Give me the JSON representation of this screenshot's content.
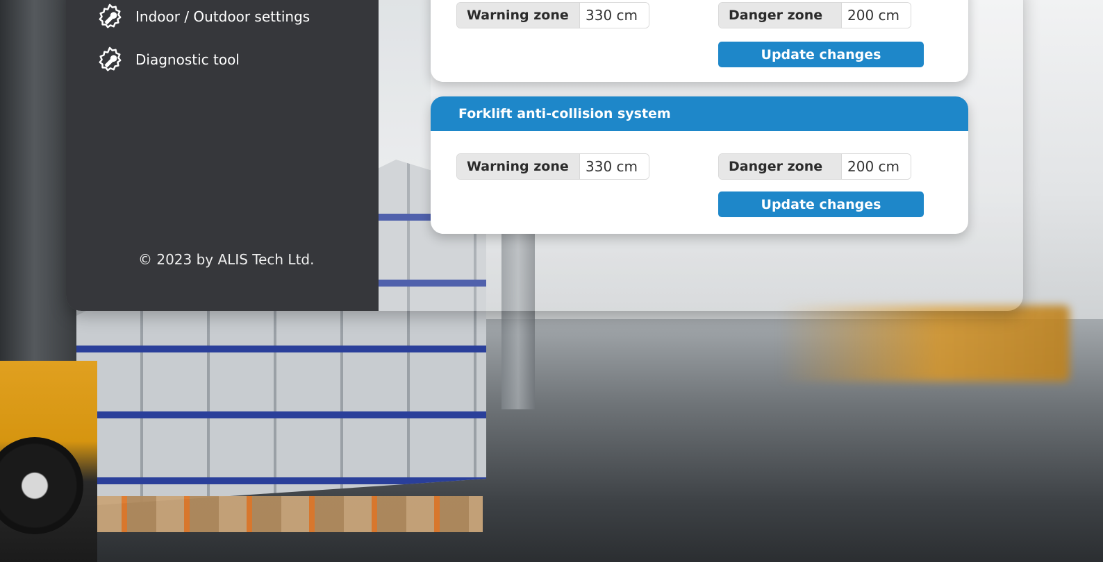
{
  "sidebar": {
    "items": [
      {
        "label": "Indoor / Outdoor settings",
        "icon": "wrench-gear-icon"
      },
      {
        "label": "Diagnostic tool",
        "icon": "wrench-gear-icon"
      }
    ],
    "copyright": "© 2023 by ALIS Tech Ltd."
  },
  "cards": [
    {
      "title": "",
      "warning_label": "Warning zone",
      "warning_value": "330 cm",
      "danger_label": "Danger zone",
      "danger_value": "200 cm",
      "button_label": "Update changes"
    },
    {
      "title": "Forklift anti-collision system",
      "warning_label": "Warning zone",
      "warning_value": "330 cm",
      "danger_label": "Danger zone",
      "danger_value": "200 cm",
      "button_label": "Update changes"
    }
  ],
  "colors": {
    "accent": "#1e87c9",
    "sidebar": "#36373b"
  }
}
